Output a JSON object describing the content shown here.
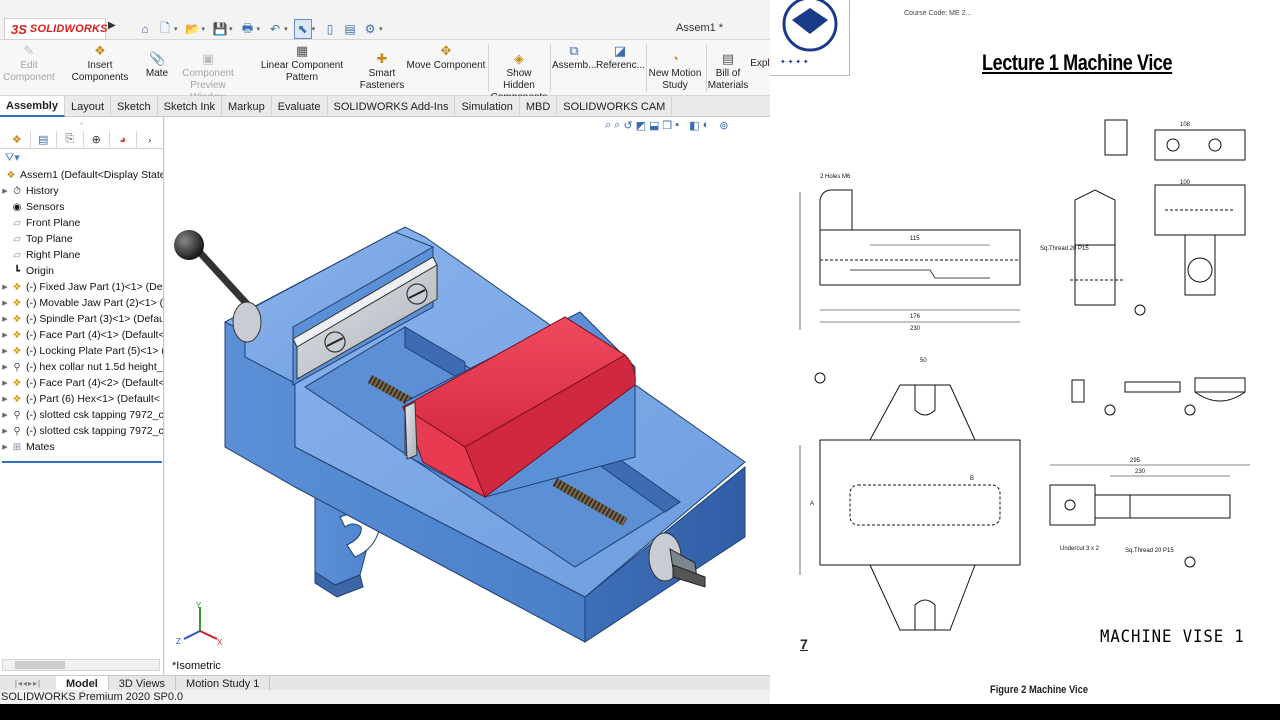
{
  "app": {
    "logo_text": "SOLIDWORKS",
    "logo_mark": "3S",
    "document_title": "Assem1 *"
  },
  "ribbon": {
    "buttons": [
      {
        "label": "Edit Component",
        "icon": "edit-component-icon"
      },
      {
        "label": "Insert Components",
        "icon": "insert-components-icon"
      },
      {
        "label": "Mate",
        "icon": "mate-icon"
      },
      {
        "label": "Component Preview Window",
        "icon": "preview-window-icon"
      },
      {
        "label": "Linear Component Pattern",
        "icon": "linear-pattern-icon"
      },
      {
        "label": "Smart Fasteners",
        "icon": "smart-fasteners-icon"
      },
      {
        "label": "Move Component",
        "icon": "move-component-icon"
      },
      {
        "label": "Show Hidden Components",
        "icon": "show-hidden-icon"
      },
      {
        "label": "Assemb...",
        "icon": "assembly-features-icon"
      },
      {
        "label": "Referenc...",
        "icon": "reference-geometry-icon"
      },
      {
        "label": "New Motion Study",
        "icon": "motion-study-icon"
      },
      {
        "label": "Bill of Materials",
        "icon": "bom-icon"
      },
      {
        "label": "Expl",
        "icon": "exploded-view-icon"
      }
    ]
  },
  "command_tabs": [
    "Assembly",
    "Layout",
    "Sketch",
    "Sketch Ink",
    "Markup",
    "Evaluate",
    "SOLIDWORKS Add-Ins",
    "Simulation",
    "MBD",
    "SOLIDWORKS CAM"
  ],
  "active_tab": "Assembly",
  "tree": {
    "root": "Assem1  (Default<Display State-",
    "items": [
      {
        "label": "History",
        "icon": "history-icon",
        "expand": true
      },
      {
        "label": "Sensors",
        "icon": "sensors-icon",
        "expand": false
      },
      {
        "label": "Front Plane",
        "icon": "plane-icon",
        "expand": false
      },
      {
        "label": "Top Plane",
        "icon": "plane-icon",
        "expand": false
      },
      {
        "label": "Right Plane",
        "icon": "plane-icon",
        "expand": false
      },
      {
        "label": "Origin",
        "icon": "origin-icon",
        "expand": false
      },
      {
        "label": "(-) Fixed Jaw Part (1)<1> (Def",
        "icon": "part-icon",
        "expand": true
      },
      {
        "label": "(-) Movable Jaw Part (2)<1> (",
        "icon": "part-icon",
        "expand": true
      },
      {
        "label": "(-) Spindle Part (3)<1> (Defau",
        "icon": "part-icon",
        "expand": true
      },
      {
        "label": "(-) Face Part (4)<1> (Default<",
        "icon": "part-icon",
        "expand": true
      },
      {
        "label": "(-) Locking Plate Part (5)<1> (",
        "icon": "part-icon",
        "expand": true
      },
      {
        "label": "(-) hex collar nut 1.5d height_",
        "icon": "bolt-icon",
        "expand": true
      },
      {
        "label": "(-) Face Part (4)<2> (Default<",
        "icon": "part-icon",
        "expand": true
      },
      {
        "label": "(-) Part (6) Hex<1> (Default<",
        "icon": "part-icon",
        "expand": true
      },
      {
        "label": "(-) slotted csk tapping 7972_c",
        "icon": "bolt-icon",
        "expand": true
      },
      {
        "label": "(-) slotted csk tapping 7972_c",
        "icon": "bolt-icon",
        "expand": true
      },
      {
        "label": "Mates",
        "icon": "mates-icon",
        "expand": true
      }
    ]
  },
  "viewport": {
    "view_label": "*Isometric"
  },
  "bottom_tabs": [
    "Model",
    "3D Views",
    "Motion Study 1"
  ],
  "active_bottom_tab": "Model",
  "status_bar": "SOLIDWORKS Premium 2020 SP0.0",
  "pdf": {
    "top_cut_text": "Course Code: ME 2...",
    "title": "Lecture 1 Machine Vice",
    "vise_label": "MACHINE  VISE 1",
    "page_number": "7",
    "caption": "Figure 2 Machine Vice"
  },
  "colors": {
    "vise_body": "#5b8fd6",
    "movable_jaw": "#e0324a",
    "jaw_plate": "#b9bec7",
    "accent": "#2f6fc0",
    "brand_red": "#d9201c"
  }
}
